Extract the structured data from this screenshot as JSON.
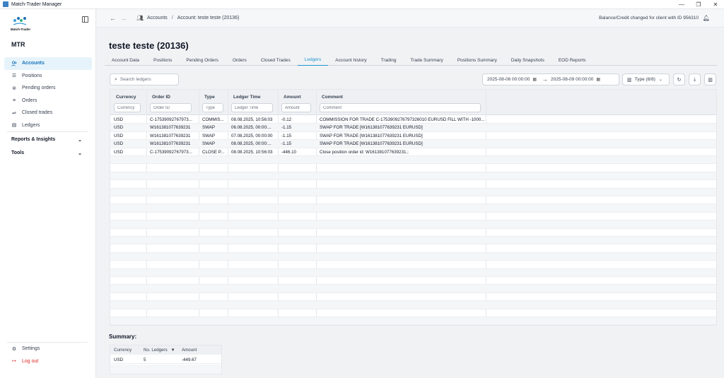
{
  "window": {
    "title": "Match-Trader Manager",
    "controls": [
      "—",
      "❐",
      "✕"
    ]
  },
  "sidebar": {
    "logo_text": "Match-Trader",
    "org": "MTR",
    "items": [
      {
        "label": "Accounts",
        "icon": "users-icon",
        "active": true
      },
      {
        "label": "Positions",
        "icon": "list-icon"
      },
      {
        "label": "Pending orders",
        "icon": "pending-icon"
      },
      {
        "label": "Orders",
        "icon": "orders-icon"
      },
      {
        "label": "Closed trades",
        "icon": "closed-trades-icon"
      },
      {
        "label": "Ledgers",
        "icon": "ledger-icon"
      }
    ],
    "sections": [
      {
        "label": "Reports & Insights"
      },
      {
        "label": "Tools"
      }
    ],
    "bottom": [
      {
        "label": "Settings",
        "icon": "gear-icon"
      },
      {
        "label": "Log out",
        "icon": "logout-icon"
      }
    ]
  },
  "topbar": {
    "breadcrumb_root": "Accounts",
    "breadcrumb_sep": "/",
    "breadcrumb_current": "Account: teste teste (20136)",
    "notice": "Balance/Credit changed for client with ID 956310"
  },
  "page": {
    "title": "teste teste (20136)"
  },
  "tabs": [
    {
      "label": "Account Data"
    },
    {
      "label": "Positions"
    },
    {
      "label": "Pending Orders"
    },
    {
      "label": "Orders"
    },
    {
      "label": "Closed Trades"
    },
    {
      "label": "Ledgers",
      "active": true
    },
    {
      "label": "Account history"
    },
    {
      "label": "Trading"
    },
    {
      "label": "Trade Summary"
    },
    {
      "label": "Positions Summary"
    },
    {
      "label": "Daily Snapshots"
    },
    {
      "label": "EOD Reports"
    }
  ],
  "toolbar": {
    "search_placeholder": "Search ledgers",
    "date_from": "2025-08-06 00:00:00",
    "date_to": "2025-08-09 00:00:00",
    "date_arrow": "→",
    "type_filter": "Type (8/8)"
  },
  "grid": {
    "columns": [
      {
        "label": "Currency",
        "filter": "Currency"
      },
      {
        "label": "Order ID",
        "filter": "Order ID"
      },
      {
        "label": "Type",
        "filter": "Type"
      },
      {
        "label": "Ledger Time",
        "filter": "Ledger Time"
      },
      {
        "label": "Amount",
        "filter": "Amount"
      },
      {
        "label": "Comment",
        "filter": "Comment"
      }
    ],
    "rows": [
      [
        "USD",
        "C-17539092767973...",
        "COMMIS...",
        "08.08.2025, 10:56:03",
        "-0.12",
        "COMMISSION FOR TRADE C-1753909276797326010 EURUSD FILL WITH -1000..."
      ],
      [
        "USD",
        "W161381077639231",
        "SWAP",
        "06.08.2025, 00:00:...",
        "-1.15",
        "SWAP FOR TRADE [W161381077639231 EURUSD]"
      ],
      [
        "USD",
        "W161381077639231",
        "SWAP",
        "07.08.2025, 00:00:00",
        "-1.15",
        "SWAP FOR TRADE [W161381077639231 EURUSD]"
      ],
      [
        "USD",
        "W161381077639231",
        "SWAP",
        "08.08.2025, 00:00:...",
        "-1.15",
        "SWAP FOR TRADE [W161381077639231 EURUSD]"
      ],
      [
        "USD",
        "C-17539092767973...",
        "CLOSE P...",
        "08.08.2025, 10:56:03",
        "-446.10",
        "Close position order id: W161381077639231.;"
      ]
    ]
  },
  "summary": {
    "title": "Summary:",
    "columns": [
      "Currency",
      "No. Ledgers",
      "Amount"
    ],
    "sort_icon": "▼",
    "rows": [
      [
        "USD",
        "5",
        "-449.67"
      ]
    ]
  },
  "colors": {
    "accent": "#2196d3",
    "active_bg": "#e6f3fb",
    "danger": "#dc2626"
  }
}
